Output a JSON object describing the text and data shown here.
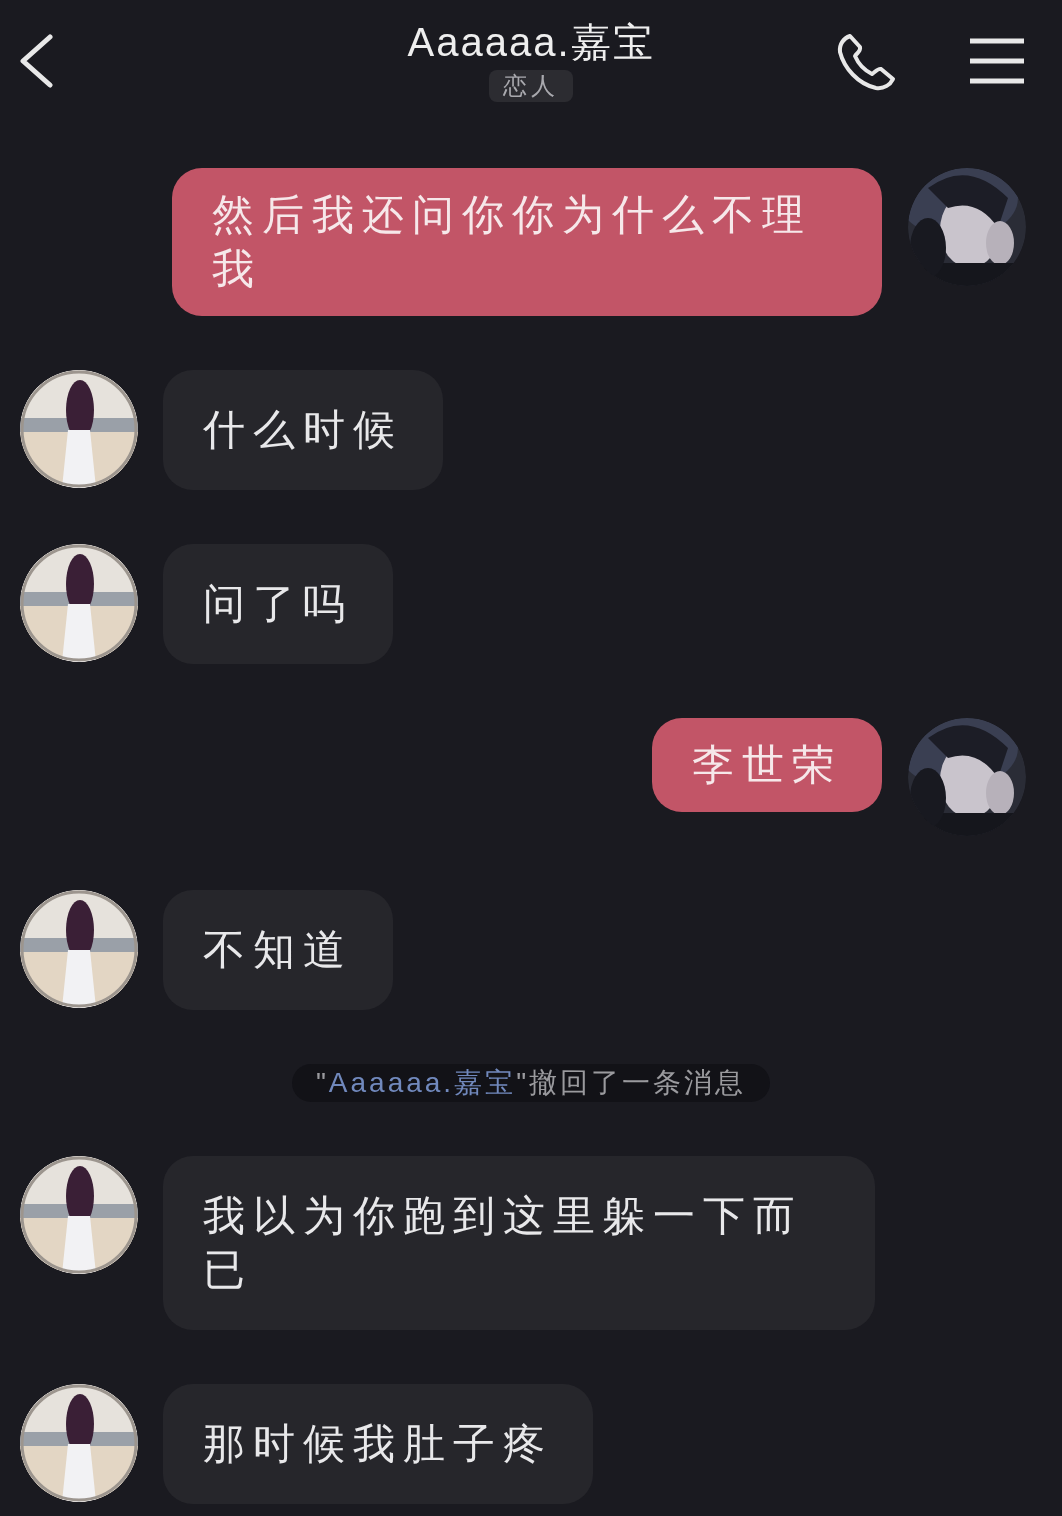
{
  "header": {
    "title": "Aaaaaa.嘉宝",
    "badge": "恋人"
  },
  "messages": [
    {
      "kind": "sent",
      "text": "然后我还问你你为什么不理我"
    },
    {
      "kind": "received",
      "text": "什么时候"
    },
    {
      "kind": "received",
      "text": "问了吗"
    },
    {
      "kind": "sent",
      "text": "李世荣"
    },
    {
      "kind": "received",
      "text": "不知道"
    },
    {
      "kind": "recall",
      "parts": [
        {
          "text": "\"",
          "highlight": false
        },
        {
          "text": "Aaaaaa.嘉宝",
          "highlight": true
        },
        {
          "text": "\"撤回了一条消息",
          "highlight": false
        }
      ]
    },
    {
      "kind": "received",
      "text": "我以为你跑到这里躲一下而已"
    },
    {
      "kind": "received",
      "text": "那时候我肚子疼"
    }
  ]
}
